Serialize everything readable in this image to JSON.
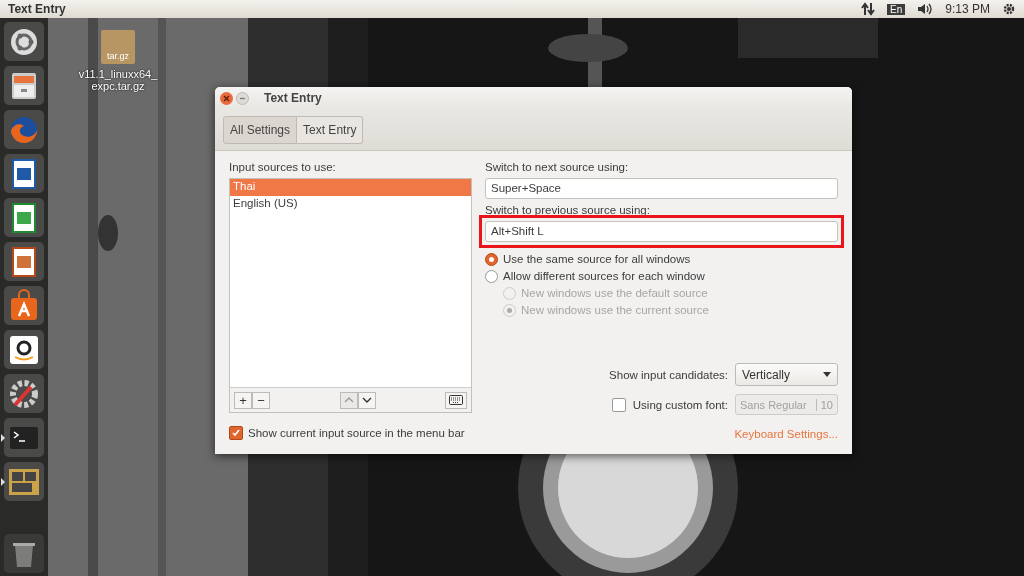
{
  "top_bar": {
    "title": "Text Entry",
    "keyboard_indicator": "En",
    "clock": "9:13 PM"
  },
  "launcher": [
    {
      "kind": "ubuntu",
      "running": false
    },
    {
      "kind": "files",
      "running": false
    },
    {
      "kind": "firefox",
      "running": false
    },
    {
      "kind": "writer",
      "running": false
    },
    {
      "kind": "calc",
      "running": false
    },
    {
      "kind": "impress",
      "running": false
    },
    {
      "kind": "software",
      "running": false
    },
    {
      "kind": "amazon",
      "running": false
    },
    {
      "kind": "settings",
      "running": false
    },
    {
      "kind": "terminal",
      "running": true
    },
    {
      "kind": "workspaces",
      "running": true
    },
    {
      "kind": "trash",
      "running": false
    }
  ],
  "desktop_icons": [
    {
      "badge": "tar.gz",
      "label_lines": [
        "v11.1_linuxx64_",
        "expc.tar.gz"
      ]
    }
  ],
  "window": {
    "title": "Text Entry",
    "breadcrumbs": [
      {
        "label": "All Settings",
        "selected": false
      },
      {
        "label": "Text Entry",
        "selected": true
      }
    ],
    "sources_label": "Input sources to use:",
    "sources": [
      {
        "label": "Thai",
        "selected": true
      },
      {
        "label": "English (US)",
        "selected": false
      }
    ],
    "list_buttons": [
      "+",
      "−"
    ],
    "show_in_menu_bar": {
      "label": "Show current input source in the menu bar",
      "checked": true
    },
    "next_label": "Switch to next source using:",
    "next_value": "Super+Space",
    "prev_label": "Switch to previous source using:",
    "prev_value": "Alt+Shift L",
    "prev_highlighted": true,
    "window_modes": [
      {
        "label": "Use the same source for all windows",
        "selected": true,
        "disabled": false
      },
      {
        "label": "Allow different sources for each window",
        "selected": false,
        "disabled": false,
        "children": [
          {
            "label": "New windows use the default source",
            "selected": false,
            "disabled": true
          },
          {
            "label": "New windows use the current source",
            "selected": true,
            "disabled": true
          }
        ]
      }
    ],
    "candidates": {
      "label": "Show input candidates:",
      "value": "Vertically"
    },
    "custom_font": {
      "label": "Using custom font:",
      "checked": false,
      "font": "Sans Regular",
      "size": "10",
      "disabled": true
    },
    "keyboard_settings": "Keyboard Settings..."
  }
}
